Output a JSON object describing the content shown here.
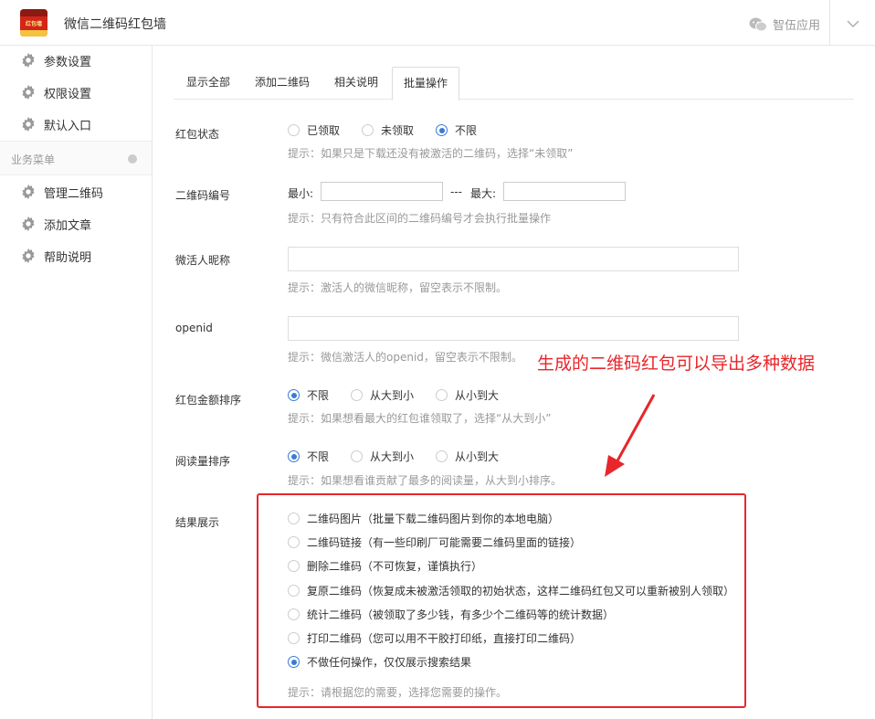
{
  "header": {
    "logo_text": "红包墙",
    "title": "微信二维码红包墙",
    "brand": "智伍应用",
    "brand_icon": "wechat-icon",
    "menu_icon": "chevron-down-icon"
  },
  "sidebar": {
    "items_top": [
      {
        "label": "参数设置",
        "icon": "gear-icon"
      },
      {
        "label": "权限设置",
        "icon": "gear-icon"
      },
      {
        "label": "默认入口",
        "icon": "gear-icon"
      }
    ],
    "group_label": "业务菜单",
    "items_bottom": [
      {
        "label": "管理二维码",
        "icon": "gear-icon"
      },
      {
        "label": "添加文章",
        "icon": "gear-icon"
      },
      {
        "label": "帮助说明",
        "icon": "gear-icon"
      }
    ]
  },
  "tabs": [
    {
      "label": "显示全部",
      "active": false
    },
    {
      "label": "添加二维码",
      "active": false
    },
    {
      "label": "相关说明",
      "active": false
    },
    {
      "label": "批量操作",
      "active": true
    }
  ],
  "form": {
    "status": {
      "label": "红包状态",
      "options": [
        "已领取",
        "未领取",
        "不限"
      ],
      "selected": "不限",
      "hint": "提示：如果只是下载还没有被激活的二维码，选择“未领取”"
    },
    "code_range": {
      "label": "二维码编号",
      "min_label": "最小:",
      "sep": "---",
      "max_label": "最大:",
      "min_value": "",
      "max_value": "",
      "hint": "提示：只有符合此区间的二维码编号才会执行批量操作"
    },
    "nickname": {
      "label": "微活人昵称",
      "value": "",
      "hint": "提示：激活人的微信昵称，留空表示不限制。"
    },
    "openid": {
      "label": "openid",
      "value": "",
      "hint": "提示：微信激活人的openid，留空表示不限制。"
    },
    "amount_sort": {
      "label": "红包金额排序",
      "options": [
        "不限",
        "从大到小",
        "从小到大"
      ],
      "selected": "不限",
      "hint": "提示：如果想看最大的红包谁领取了，选择“从大到小”"
    },
    "read_sort": {
      "label": "阅读量排序",
      "options": [
        "不限",
        "从大到小",
        "从小到大"
      ],
      "selected": "不限",
      "hint": "提示：如果想看谁贡献了最多的阅读量，从大到小排序。"
    },
    "result": {
      "label": "结果展示",
      "options": [
        "二维码图片（批量下载二维码图片到你的本地电脑）",
        "二维码链接（有一些印刷厂可能需要二维码里面的链接）",
        "删除二维码（不可恢复，谨慎执行）",
        "复原二维码（恢复成未被激活领取的初始状态，这样二维码红包又可以重新被别人领取）",
        "统计二维码（被领取了多少钱，有多少个二维码等的统计数据）",
        "打印二维码（您可以用不干胶打印纸，直接打印二维码）",
        "不做任何操作，仅仅展示搜索结果"
      ],
      "selected_index": 6,
      "hint": "提示：请根据您的需要，选择您需要的操作。"
    }
  },
  "annotation": {
    "text": "生成的二维码红包可以导出多种数据",
    "color": "#e8262b"
  },
  "colors": {
    "accent": "#3a7bd5",
    "annotation": "#e8262b"
  }
}
